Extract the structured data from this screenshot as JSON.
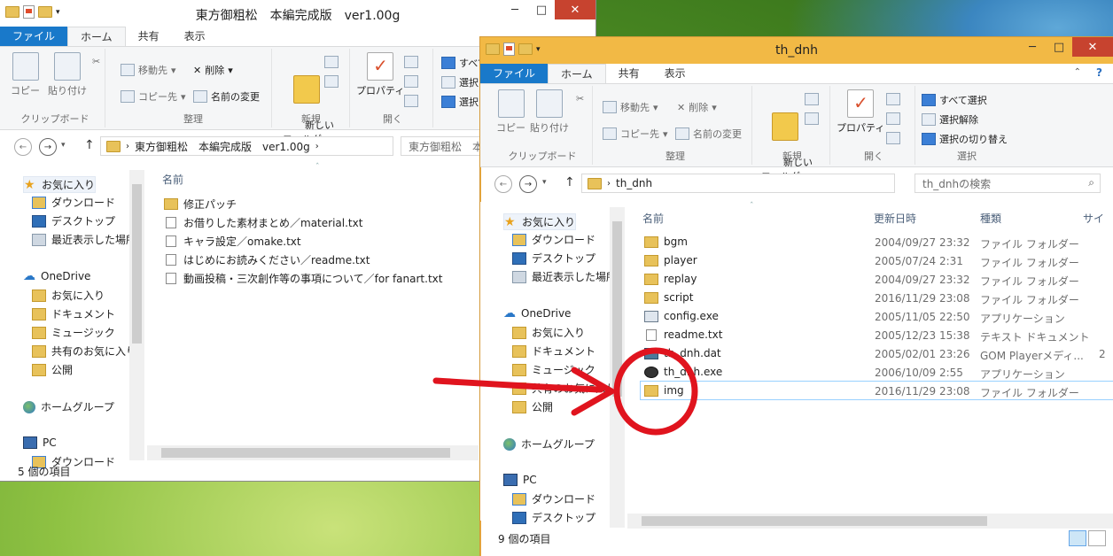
{
  "window1": {
    "title": "東方御粗松　本編完成版　ver1.00g",
    "tabs": [
      "ファイル",
      "ホーム",
      "共有",
      "表示"
    ],
    "ribbon": {
      "clipboard": {
        "copy": "コピー",
        "paste": "貼り付け",
        "label": "クリップボード"
      },
      "organize": {
        "move_to": "移動先",
        "copy_to": "コピー先",
        "delete": "削除",
        "rename": "名前の変更",
        "label": "整理"
      },
      "new": {
        "new_folder": "新しい\nフォルダー",
        "label": "新規"
      },
      "open": {
        "properties": "プロパティ",
        "label": "開く"
      },
      "select": {
        "select_all": "すべて",
        "select_none": "選択",
        "invert": "選択"
      }
    },
    "address": {
      "path": "東方御粗松　本編完成版　ver1.00g",
      "search_placeholder": "東方御粗松　本"
    },
    "nav": [
      {
        "label": "お気に入り",
        "icon": "star-icon"
      },
      {
        "label": "ダウンロード",
        "icon": "download-folder-icon"
      },
      {
        "label": "デスクトップ",
        "icon": "desktop-icon"
      },
      {
        "label": "最近表示した場所",
        "icon": "recent-places-icon"
      },
      {
        "label": "OneDrive",
        "icon": "cloud-icon"
      },
      {
        "label": "お気に入り",
        "icon": "folder-icon"
      },
      {
        "label": "ドキュメント",
        "icon": "folder-icon"
      },
      {
        "label": "ミュージック",
        "icon": "folder-icon"
      },
      {
        "label": "共有のお気に入り",
        "icon": "folder-icon"
      },
      {
        "label": "公開",
        "icon": "folder-icon"
      },
      {
        "label": "ホームグループ",
        "icon": "homegroup-icon"
      },
      {
        "label": "PC",
        "icon": "pc-icon"
      },
      {
        "label": "ダウンロード",
        "icon": "download-folder-icon"
      }
    ],
    "column_name": "名前",
    "files": [
      {
        "name": "修正パッチ",
        "type": "folder"
      },
      {
        "name": "お借りした素材まとめ／material.txt",
        "type": "txt"
      },
      {
        "name": "キャラ設定／omake.txt",
        "type": "txt"
      },
      {
        "name": "はじめにお読みください／readme.txt",
        "type": "txt"
      },
      {
        "name": "動画投稿・三次創作等の事項について／for fanart.txt",
        "type": "txt"
      }
    ],
    "status": "5 個の項目"
  },
  "window2": {
    "title": "th_dnh",
    "tabs": [
      "ファイル",
      "ホーム",
      "共有",
      "表示"
    ],
    "ribbon": {
      "clipboard": {
        "copy": "コピー",
        "paste": "貼り付け",
        "label": "クリップボード"
      },
      "organize": {
        "move_to": "移動先",
        "copy_to": "コピー先",
        "delete": "削除",
        "rename": "名前の変更",
        "label": "整理"
      },
      "new": {
        "new_folder": "新しい\nフォルダー",
        "label": "新規"
      },
      "open": {
        "properties": "プロパティ",
        "label": "開く"
      },
      "select": {
        "select_all": "すべて選択",
        "select_none": "選択解除",
        "invert": "選択の切り替え",
        "label": "選択"
      }
    },
    "address": {
      "path": "th_dnh",
      "search_placeholder": "th_dnhの検索"
    },
    "nav": [
      {
        "label": "お気に入り",
        "icon": "star-icon"
      },
      {
        "label": "ダウンロード",
        "icon": "download-folder-icon"
      },
      {
        "label": "デスクトップ",
        "icon": "desktop-icon"
      },
      {
        "label": "最近表示した場所",
        "icon": "recent-places-icon"
      },
      {
        "label": "OneDrive",
        "icon": "cloud-icon"
      },
      {
        "label": "お気に入り",
        "icon": "folder-icon"
      },
      {
        "label": "ドキュメント",
        "icon": "folder-icon"
      },
      {
        "label": "ミュージック",
        "icon": "folder-icon"
      },
      {
        "label": "共有のお気に入り",
        "icon": "folder-icon"
      },
      {
        "label": "公開",
        "icon": "folder-icon"
      },
      {
        "label": "ホームグループ",
        "icon": "homegroup-icon"
      },
      {
        "label": "PC",
        "icon": "pc-icon"
      },
      {
        "label": "ダウンロード",
        "icon": "download-folder-icon"
      },
      {
        "label": "デスクトップ",
        "icon": "desktop-icon"
      }
    ],
    "columns": {
      "name": "名前",
      "date": "更新日時",
      "type": "種類",
      "size": "サイ"
    },
    "files": [
      {
        "name": "bgm",
        "date": "2004/09/27 23:32",
        "type": "ファイル フォルダー",
        "kind": "folder"
      },
      {
        "name": "player",
        "date": "2005/07/24 2:31",
        "type": "ファイル フォルダー",
        "kind": "folder"
      },
      {
        "name": "replay",
        "date": "2004/09/27 23:32",
        "type": "ファイル フォルダー",
        "kind": "folder"
      },
      {
        "name": "script",
        "date": "2016/11/29 23:08",
        "type": "ファイル フォルダー",
        "kind": "folder"
      },
      {
        "name": "config.exe",
        "date": "2005/11/05 22:50",
        "type": "アプリケーション",
        "kind": "exe"
      },
      {
        "name": "readme.txt",
        "date": "2005/12/23 15:38",
        "type": "テキスト ドキュメント",
        "kind": "txt"
      },
      {
        "name": "th_dnh.dat",
        "date": "2005/02/01 23:26",
        "type": "GOM Playerメディ...",
        "kind": "dat",
        "size_partial": "2"
      },
      {
        "name": "th_dnh.exe",
        "date": "2006/10/09 2:55",
        "type": "アプリケーション",
        "kind": "gom"
      },
      {
        "name": "img",
        "date": "2016/11/29 23:08",
        "type": "ファイル フォルダー",
        "kind": "folder"
      }
    ],
    "status": "9 個の項目"
  },
  "colors": {
    "file_tab": "#1979ca",
    "active_title": "#f2b945",
    "close": "#c7432f",
    "annotation": "#e0141e"
  }
}
